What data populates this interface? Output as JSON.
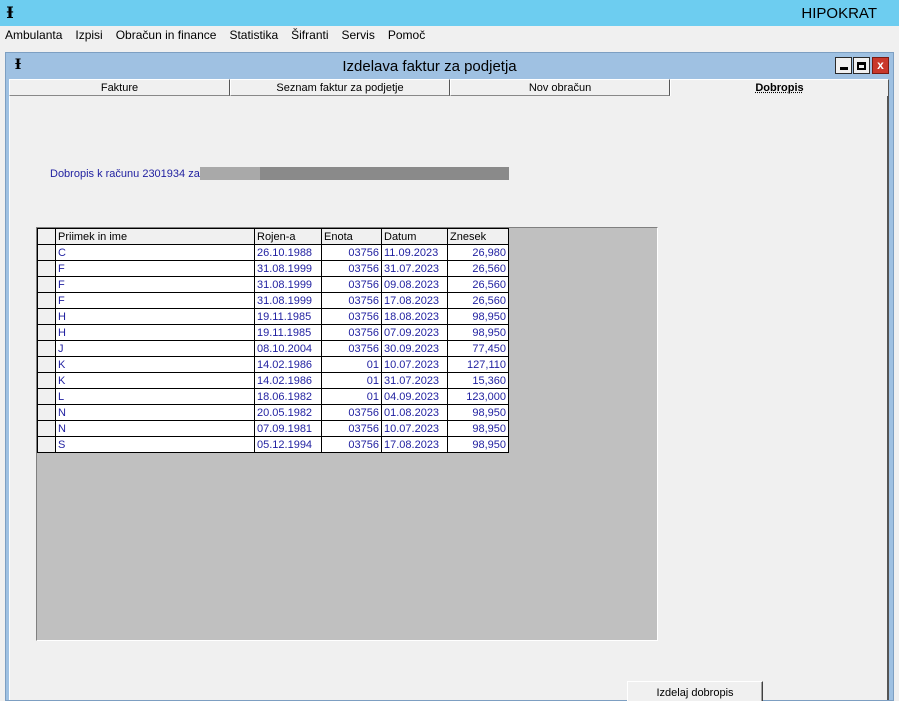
{
  "app": {
    "title": "HIPOKRAT",
    "icon": "hipokrat-icon"
  },
  "menu": [
    "Ambulanta",
    "Izpisi",
    "Obračun in finance",
    "Statistika",
    "Šifranti",
    "Servis",
    "Pomoč"
  ],
  "window": {
    "title": "Izdelava faktur za podjetja",
    "close_glyph": "x"
  },
  "tabs": [
    {
      "label": "Fakture",
      "active": false
    },
    {
      "label": "Seznam faktur za podjetje",
      "active": false
    },
    {
      "label": "Nov obračun",
      "active": false
    },
    {
      "label": "Dobropis",
      "active": true
    }
  ],
  "dobropis": {
    "label": "Dobropis k računu 2301934 za"
  },
  "grid": {
    "columns": [
      "Priimek in ime",
      "Rojen-a",
      "Enota",
      "Datum",
      "Znesek"
    ],
    "rows": [
      {
        "initial": "C",
        "dob": "26.10.1988",
        "enota": "03756",
        "datum": "11.09.2023",
        "znesek": "26,980"
      },
      {
        "initial": "F",
        "dob": "31.08.1999",
        "enota": "03756",
        "datum": "31.07.2023",
        "znesek": "26,560"
      },
      {
        "initial": "F",
        "dob": "31.08.1999",
        "enota": "03756",
        "datum": "09.08.2023",
        "znesek": "26,560"
      },
      {
        "initial": "F",
        "dob": "31.08.1999",
        "enota": "03756",
        "datum": "17.08.2023",
        "znesek": "26,560"
      },
      {
        "initial": "H",
        "dob": "19.11.1985",
        "enota": "03756",
        "datum": "18.08.2023",
        "znesek": "98,950"
      },
      {
        "initial": "H",
        "dob": "19.11.1985",
        "enota": "03756",
        "datum": "07.09.2023",
        "znesek": "98,950"
      },
      {
        "initial": "J",
        "dob": "08.10.2004",
        "enota": "03756",
        "datum": "30.09.2023",
        "znesek": "77,450"
      },
      {
        "initial": "K",
        "dob": "14.02.1986",
        "enota": "01",
        "datum": "10.07.2023",
        "znesek": "127,110"
      },
      {
        "initial": "K",
        "dob": "14.02.1986",
        "enota": "01",
        "datum": "31.07.2023",
        "znesek": "15,360"
      },
      {
        "initial": "L",
        "dob": "18.06.1982",
        "enota": "01",
        "datum": "04.09.2023",
        "znesek": "123,000"
      },
      {
        "initial": "N",
        "dob": "20.05.1982",
        "enota": "03756",
        "datum": "01.08.2023",
        "znesek": "98,950"
      },
      {
        "initial": "N",
        "dob": "07.09.1981",
        "enota": "03756",
        "datum": "10.07.2023",
        "znesek": "98,950"
      },
      {
        "initial": "S",
        "dob": "05.12.1994",
        "enota": "03756",
        "datum": "17.08.2023",
        "znesek": "98,950"
      }
    ]
  },
  "buttons": {
    "izdelaj_dobropis": "Izdelaj dobropis"
  },
  "colors": {
    "titlebar": "#6dcdf0",
    "child_title": "#9fc1e2",
    "text_blue": "#1f1fa0",
    "grid_bg": "#c0c0c0"
  }
}
